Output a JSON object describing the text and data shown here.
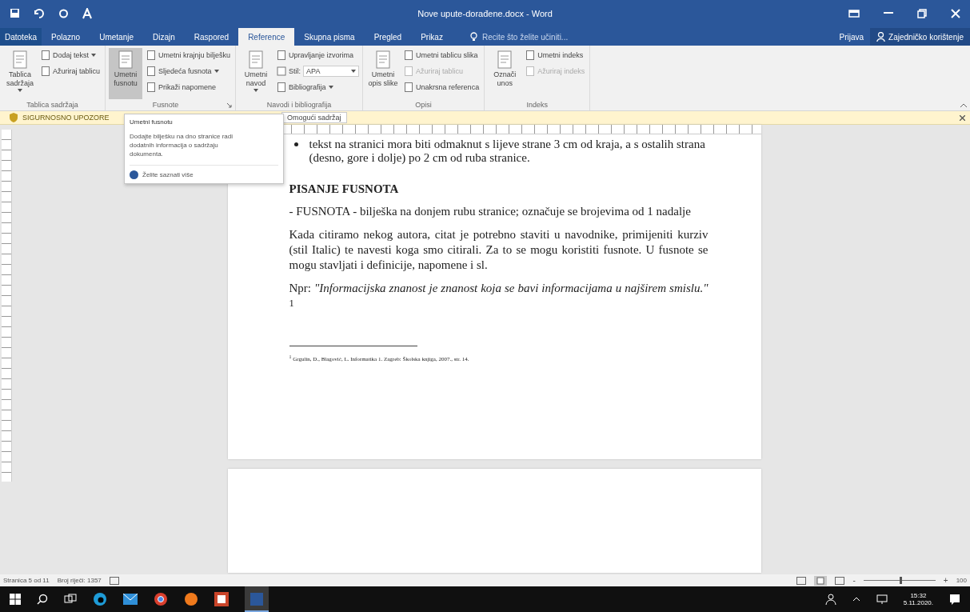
{
  "window": {
    "title": "Nove upute-dorađene.docx - Word"
  },
  "tabs": [
    {
      "label": "Datoteka",
      "selected": false,
      "kind": "file"
    },
    {
      "label": "Polazno",
      "selected": false,
      "kind": "tab"
    },
    {
      "label": "Umetanje",
      "selected": false,
      "kind": "tab"
    },
    {
      "label": "Dizajn",
      "selected": false,
      "kind": "tab"
    },
    {
      "label": "Raspored",
      "selected": false,
      "kind": "tab"
    },
    {
      "label": "Reference",
      "selected": true,
      "kind": "tab"
    },
    {
      "label": "Skupna pisma",
      "selected": false,
      "kind": "tab"
    },
    {
      "label": "Pregled",
      "selected": false,
      "kind": "tab"
    },
    {
      "label": "Prikaz",
      "selected": false,
      "kind": "tab"
    }
  ],
  "tell_me": {
    "placeholder": "Recite što želite učiniti..."
  },
  "account": {
    "sign_in": "Prijava",
    "share": "Zajedničko korištenje"
  },
  "ribbon": {
    "groups": [
      {
        "label": "Tablica sadržaja",
        "launcher": false,
        "large": [
          {
            "label": "Tablica sadržaja",
            "menu": true,
            "hovered": false
          }
        ],
        "small": [
          {
            "label": "Dodaj tekst",
            "kind": "menu",
            "disabled": false
          },
          {
            "label": "Ažuriraj tablicu",
            "kind": "button",
            "disabled": false
          }
        ]
      },
      {
        "label": "Fusnote",
        "launcher": true,
        "large": [
          {
            "label": "Umetni fusnotu",
            "menu": false,
            "hovered": true
          }
        ],
        "small": [
          {
            "label": "Umetni krajnju bilješku",
            "kind": "button",
            "disabled": false
          },
          {
            "label": "Sljedeća fusnota",
            "kind": "menu",
            "disabled": false
          },
          {
            "label": "Prikaži napomene",
            "kind": "button",
            "disabled": false
          }
        ]
      },
      {
        "label": "Navodi i bibliografija",
        "launcher": false,
        "large": [
          {
            "label": "Umetni navod",
            "menu": true,
            "hovered": false
          }
        ],
        "small": [
          {
            "label": "Upravljanje izvorima",
            "kind": "button",
            "disabled": false
          },
          {
            "label": "Stil:",
            "value": "APA",
            "kind": "dropdown"
          },
          {
            "label": "Bibliografija",
            "kind": "menu",
            "disabled": false
          }
        ]
      },
      {
        "label": "Opisi",
        "launcher": false,
        "large": [
          {
            "label": "Umetni opis slike",
            "menu": false,
            "hovered": false
          }
        ],
        "small": [
          {
            "label": "Umetni tablicu slika",
            "kind": "button",
            "disabled": false
          },
          {
            "label": "Ažuriraj tablicu",
            "kind": "button",
            "disabled": true
          },
          {
            "label": "Unakrsna referenca",
            "kind": "button",
            "disabled": false
          }
        ]
      },
      {
        "label": "Indeks",
        "launcher": false,
        "large": [
          {
            "label": "Označi unos",
            "menu": false,
            "hovered": false
          }
        ],
        "small": [
          {
            "label": "Umetni indeks",
            "kind": "button",
            "disabled": false
          },
          {
            "label": "Ažuriraj indeks",
            "kind": "button",
            "disabled": true
          }
        ]
      }
    ]
  },
  "warning": {
    "label": "SIGURNOSNO UPOZORE",
    "button": "Omogući sadržaj"
  },
  "tooltip": {
    "title": "Umetni fusnotu",
    "description": "Dodajte bilješku na dno stranice radi dodatnih informacija o sadržaju dokumenta.",
    "link": "Želite saznati više"
  },
  "document": {
    "bullets": [
      "tekst na stranici mora biti odmaknut s lijeve strane 3 cm od kraja, a s ostalih strana (desno, gore i dolje) po 2 cm od ruba stranice."
    ],
    "heading": "PISANJE FUSNOTA",
    "paragraphs": [
      {
        "kind": "plain",
        "text": "- FUSNOTA - bilješka na donjem rubu stranice; označuje se brojevima od 1 nadalje"
      },
      {
        "kind": "plain",
        "text": "Kada citiramo nekog autora, citat je potrebno staviti u navodnike, primijeniti kurziv (stil Italic) te navesti koga smo citirali. Za to se mogu koristiti fusnote. U fusnote se mogu stavljati i definicije, napomene i sl."
      },
      {
        "kind": "plain",
        "text": "Npr: *\"Informacijska znanost je znanost koja se bavi informacijama u najširem smislu.\"* $^{1}$"
      }
    ],
    "footnote": "$^{1}$ Grgulin, D., Blagović, L. Informatika 1. Zagreb: Školska knjiga, 2007., str. 14."
  },
  "status_bar": {
    "page": "Stranica 5 od 11",
    "words": "Broj riječi: 1357",
    "zoom_out": "-",
    "zoom_slider": {
      "level": 0.5
    },
    "zoom_in": "+",
    "zoom": "100"
  },
  "taskbar": {
    "time": "15:32",
    "date": "5.11.2020."
  }
}
